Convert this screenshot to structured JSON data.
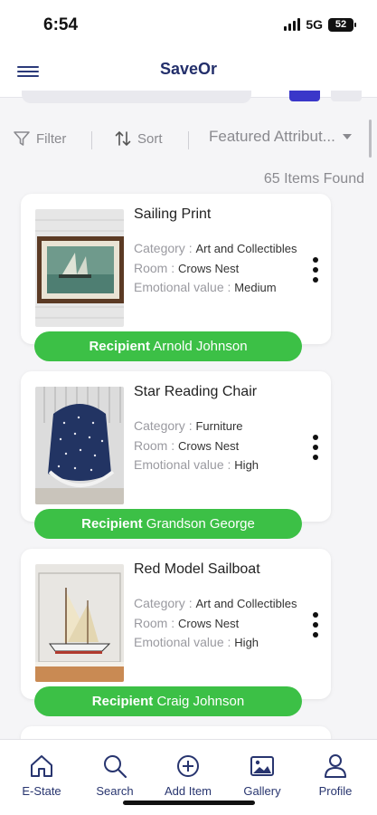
{
  "status_bar": {
    "time": "6:54",
    "network": "5G",
    "battery": "52"
  },
  "header": {
    "title": "SaveOr"
  },
  "toolbar": {
    "filter_label": "Filter",
    "sort_label": "Sort",
    "featured_label": "Featured Attribut..."
  },
  "results": {
    "count_text": "65 Items Found"
  },
  "items": [
    {
      "title": "Sailing Print",
      "category_label": "Category :",
      "category": "Art and Collectibles",
      "room_label": "Room :",
      "room": "Crows Nest",
      "emotional_label": "Emotional value :",
      "emotional": "Medium",
      "recipient_label": "Recipient",
      "recipient": "Arnold Johnson"
    },
    {
      "title": "Star Reading Chair",
      "category_label": "Category :",
      "category": "Furniture",
      "room_label": "Room :",
      "room": "Crows Nest",
      "emotional_label": "Emotional value :",
      "emotional": "High",
      "recipient_label": "Recipient",
      "recipient": "Grandson George"
    },
    {
      "title": "Red Model Sailboat",
      "category_label": "Category :",
      "category": "Art and Collectibles",
      "room_label": "Room :",
      "room": "Crows Nest",
      "emotional_label": "Emotional value :",
      "emotional": "High",
      "recipient_label": "Recipient",
      "recipient": "Craig Johnson"
    }
  ],
  "tabs": [
    {
      "label": "E-State",
      "icon": "home-icon"
    },
    {
      "label": "Search",
      "icon": "search-icon"
    },
    {
      "label": "Add Item",
      "icon": "plus-circle-icon"
    },
    {
      "label": "Gallery",
      "icon": "gallery-icon"
    },
    {
      "label": "Profile",
      "icon": "profile-icon"
    }
  ],
  "colors": {
    "brand": "#232f6b",
    "recipient_green": "#3cc046",
    "accent_blue": "#3a37c9"
  }
}
